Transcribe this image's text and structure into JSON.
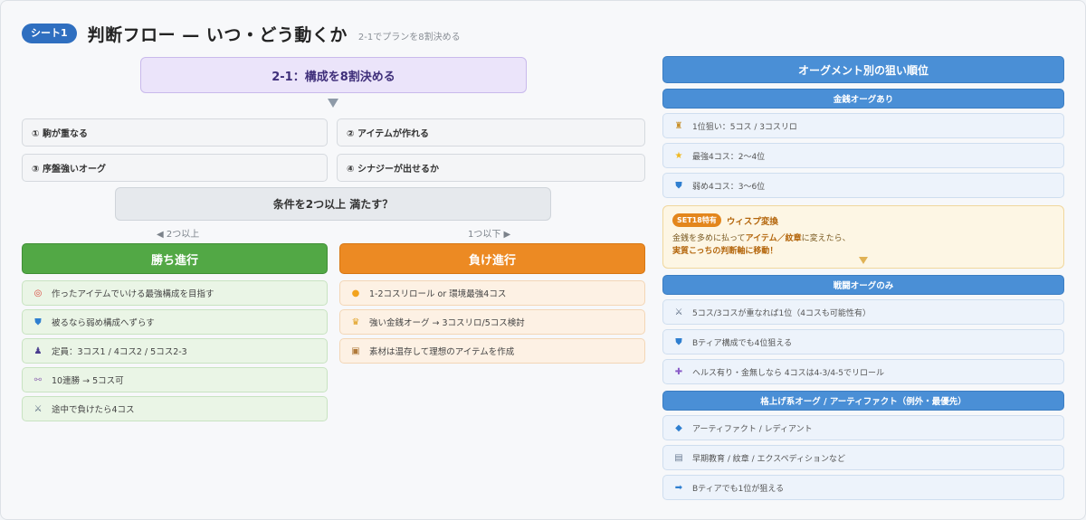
{
  "header": {
    "sheet_badge": "シート1",
    "title": "判断フロー — いつ・どう動くか",
    "subtitle": "2-1でプランを8割決める"
  },
  "flow": {
    "top": "2-1：構成を8割決める",
    "conditions": [
      "① 駒が重なる",
      "② アイテムが作れる",
      "③ 序盤強いオーグ",
      "④ シナジーが出せるか"
    ],
    "question": "条件を2つ以上 満たす？",
    "left_label": "◀ 2つ以上",
    "right_label": "1つ以下 ▶"
  },
  "win": {
    "title": "勝ち進行",
    "items": [
      {
        "icon": "target-icon",
        "glyph": "◎",
        "text": "作ったアイテムでいける最強構成を目指す"
      },
      {
        "icon": "shield-icon",
        "glyph": "⛊",
        "text": "被るなら弱め構成へずらす"
      },
      {
        "icon": "chess-pawn-icon",
        "glyph": "♟",
        "text": "定員：3コス1 / 4コス2 / 5コス2-3"
      },
      {
        "icon": "link-icon",
        "glyph": "⚯",
        "text": "10連勝 → 5コス可"
      },
      {
        "icon": "crossed-swords-icon",
        "glyph": "⚔",
        "text": "途中で負けたら4コス"
      }
    ]
  },
  "lose": {
    "title": "負け進行",
    "items": [
      {
        "icon": "coin-icon",
        "glyph": "●",
        "text": "1-2コスリロール or 環境最強4コス"
      },
      {
        "icon": "crown-icon",
        "glyph": "♛",
        "text": "強い金銭オーグ → 3コスリロ/5コス検討"
      },
      {
        "icon": "package-icon",
        "glyph": "▣",
        "text": "素材は温存して理想のアイテムを作成"
      }
    ]
  },
  "right": {
    "title": "オーグメント別の狙い順位",
    "sections": {
      "money": {
        "title": "金銭オーグあり",
        "items": [
          {
            "icon": "trophy-icon",
            "glyph": "♜",
            "text": "1位狙い：5コス / 3コスリロ"
          },
          {
            "icon": "star-icon",
            "glyph": "★",
            "text": "最強4コス：2〜4位"
          },
          {
            "icon": "shield-icon",
            "glyph": "⛊",
            "text": "弱め4コス：3〜6位"
          }
        ]
      },
      "note": {
        "badge": "SET18特有",
        "title": "ウィスプ変換",
        "line1_pre": "金銭を多めに払って",
        "line1_bold": "アイテム／紋章",
        "line1_post": "に変えたら、",
        "line2": "実質こっちの判断軸に移動！"
      },
      "combat": {
        "title": "戦闘オーグのみ",
        "items": [
          {
            "icon": "crossed-swords-icon",
            "glyph": "⚔",
            "text": "5コス/3コスが重なれば1位（4コスも可能性有）"
          },
          {
            "icon": "shield-icon",
            "glyph": "⛊",
            "text": "Bティア構成でも4位狙える"
          },
          {
            "icon": "plus-icon",
            "glyph": "✚",
            "text": "ヘルス有り・金無しなら 4コスは4-3/4-5でリロール"
          }
        ]
      },
      "upgrade": {
        "title": "格上げ系オーグ / アーティファクト（例外・最優先）",
        "items": [
          {
            "icon": "diamond-icon",
            "glyph": "◆",
            "text": "アーティファクト / レディアント"
          },
          {
            "icon": "book-icon",
            "glyph": "▤",
            "text": "早期教育 / 紋章 / エクスペディションなど"
          },
          {
            "icon": "arrow-right-icon",
            "glyph": "➡",
            "text": "Bティアでも1位が狙える"
          }
        ]
      }
    }
  },
  "colors": {
    "accent_blue": "#4a8fd6",
    "win_green": "#52a845",
    "lose_orange": "#ec8a23",
    "note_orange": "#e3861c"
  }
}
